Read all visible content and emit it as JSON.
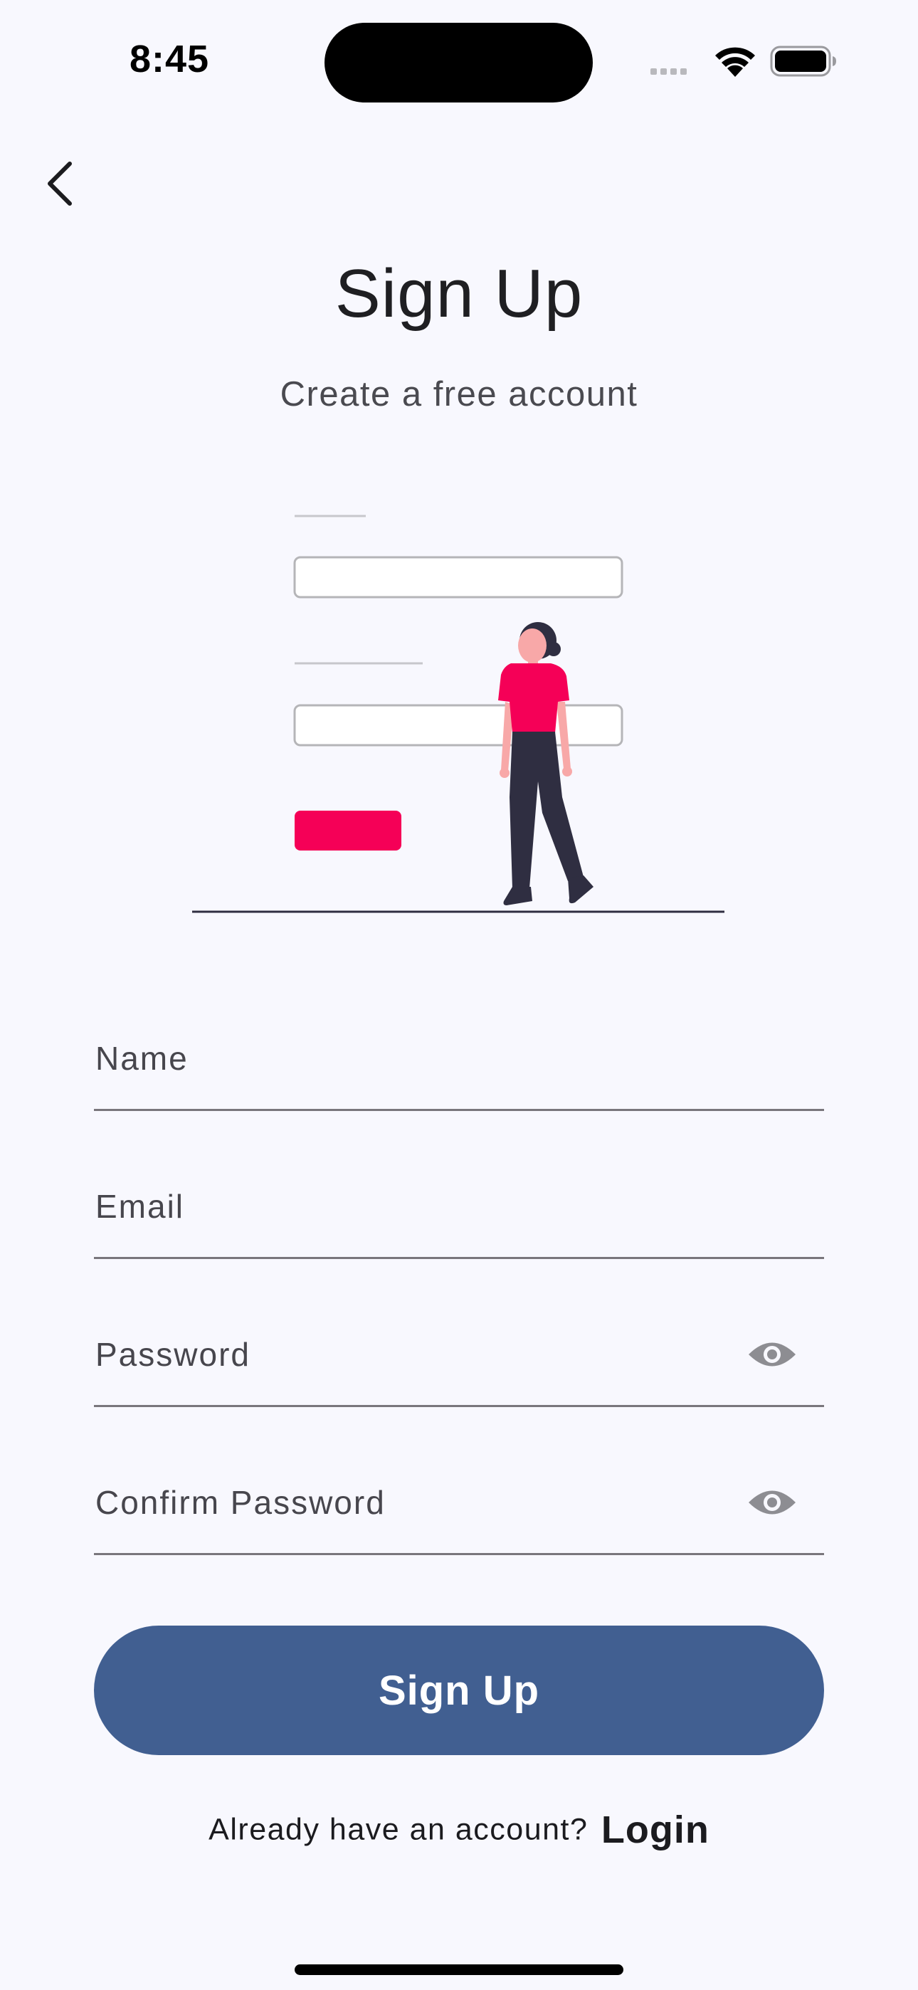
{
  "status_bar": {
    "time": "8:45",
    "wifi_icon": "wifi-icon",
    "battery_icon": "battery-icon"
  },
  "header": {
    "back_icon": "chevron-left-icon",
    "title": "Sign Up",
    "subtitle": "Create a free account"
  },
  "illustration": {
    "description_icon": "signup-illustration",
    "accent_color": "#f50057",
    "figure_color": "#2f2e41"
  },
  "form": {
    "name_label": "Name",
    "email_label": "Email",
    "password_label": "Password",
    "confirm_password_label": "Confirm Password",
    "visibility_icon": "eye-icon"
  },
  "actions": {
    "signup_label": "Sign Up",
    "button_color": "#415f91"
  },
  "footer": {
    "prompt": "Already have an account?",
    "login_label": "Login"
  }
}
